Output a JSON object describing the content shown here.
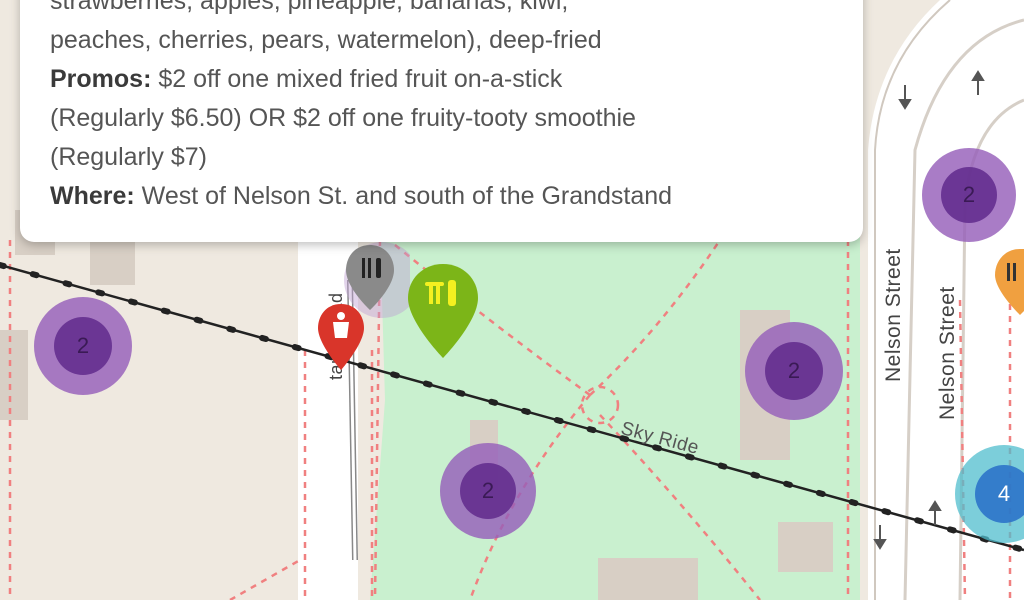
{
  "map": {
    "streets": {
      "nelson_1": "Nelson Street",
      "nelson_2": "Nelson Street",
      "grandstand": "tand Road",
      "sky_ride": "Sky Ride"
    },
    "clusters": [
      {
        "count": "2",
        "color": "purple"
      },
      {
        "count": "2",
        "color": "purple"
      },
      {
        "count": "2",
        "color": "purple"
      },
      {
        "count": "2",
        "color": "purple"
      },
      {
        "count": "4",
        "color": "teal"
      }
    ],
    "pin_colors": {
      "selected": "#7cb518",
      "secondary": "#8a8a8a",
      "first_aid": "#d9352a",
      "orange": "#f0a040"
    }
  },
  "callout": {
    "line1": "strawberries, apples, pineapple, bananas, kiwi,",
    "line2": "peaches, cherries, pears, watermelon), deep-fried",
    "promos_label": "Promos:",
    "promos_text_a": " $2 off one mixed fried fruit on-a-stick",
    "promos_text_b": "(Regularly $6.50) OR $2 off one fruity-tooty smoothie",
    "promos_text_c": "(Regularly $7)",
    "where_label": "Where:",
    "where_text": " West of Nelson St. and south of the Grandstand"
  }
}
